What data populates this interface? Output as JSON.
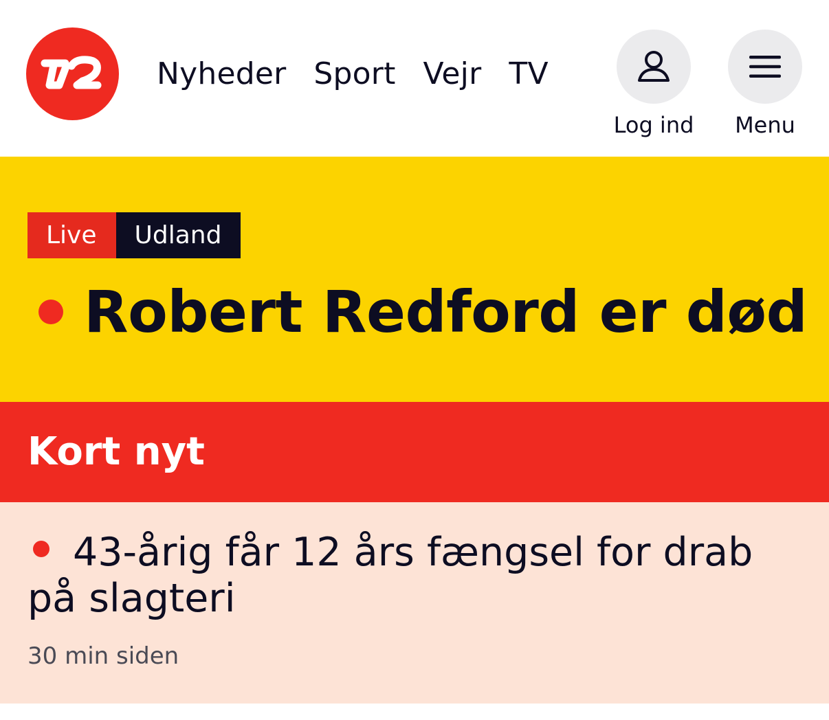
{
  "brand": {
    "logo_icon": "tv2-logo-icon",
    "accent_color": "#ef2a21",
    "highlight_color": "#fcd300"
  },
  "nav": {
    "items": [
      {
        "label": "Nyheder"
      },
      {
        "label": "Sport"
      },
      {
        "label": "Vejr"
      },
      {
        "label": "TV"
      }
    ],
    "login_label": "Log ind",
    "login_icon": "user-icon",
    "menu_label": "Menu",
    "menu_icon": "hamburger-menu-icon"
  },
  "hero": {
    "tags": {
      "live": "Live",
      "section": "Udland"
    },
    "headline": "Robert Redford er død"
  },
  "section": {
    "title": "Kort nyt"
  },
  "news": {
    "headline": "43-årig får 12 års fængsel for drab på slagteri",
    "time": "30 min siden"
  }
}
